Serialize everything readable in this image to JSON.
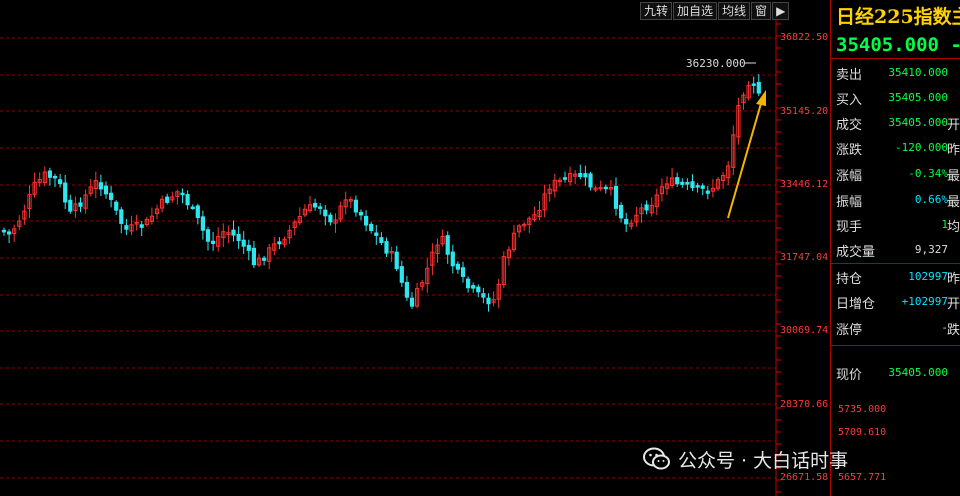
{
  "toolbar": {
    "items": [
      "九转",
      "加自选",
      "均线",
      "窗"
    ],
    "arrow": "▶"
  },
  "chart": {
    "peak_label": "36230.000",
    "y_labels": [
      "36822.50",
      "35145.20",
      "33446.12",
      "31747.04",
      "30069.74",
      "28370.66",
      "26671.58"
    ],
    "mini_labels": [
      "5735.000",
      "5709.610",
      "5657.771"
    ],
    "up_color": "#ff3232",
    "down_color": "#2ee6f0",
    "grid_color": "#8b0000",
    "arrow_color": "#f5b400"
  },
  "quote": {
    "title": "日经225指数主",
    "price": "35405.000",
    "price_suffix": "-",
    "rows": [
      {
        "key": "卖出",
        "value": "35410.000",
        "suffix": "",
        "color": "#00ff44"
      },
      {
        "key": "买入",
        "value": "35405.000",
        "suffix": "",
        "color": "#00ff44"
      },
      {
        "key": "成交",
        "value": "35405.000",
        "suffix": "开",
        "color": "#00ff44"
      },
      {
        "key": "涨跌",
        "value": "-120.000",
        "suffix": "昨",
        "color": "#00ff44"
      },
      {
        "key": "涨幅",
        "value": "-0.34%",
        "suffix": "最",
        "color": "#00ff44"
      },
      {
        "key": "振幅",
        "value": "0.66%",
        "suffix": "最",
        "color": "#00e5ff"
      },
      {
        "key": "现手",
        "value": "1",
        "suffix": "均",
        "color": "#00ff44"
      },
      {
        "key": "成交量",
        "value": "9,327",
        "suffix": "",
        "color": "#dddddd"
      },
      {
        "key": "持仓",
        "value": "102997",
        "suffix": "昨",
        "color": "#00e5ff"
      },
      {
        "key": "日增仓",
        "value": "+102997",
        "suffix": "开",
        "color": "#00e5ff"
      },
      {
        "key": "涨停",
        "value": "-",
        "suffix": "跌",
        "color": "#dddddd"
      }
    ],
    "current_label": "现价",
    "current_value": "35405.000"
  },
  "watermark": {
    "text": "公众号 · 大白话时事"
  }
}
